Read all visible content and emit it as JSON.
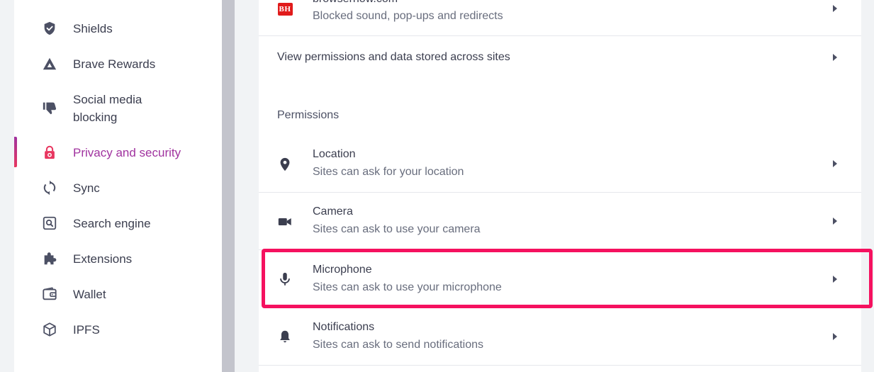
{
  "sidebar": {
    "items": [
      {
        "label": "Shields",
        "icon": "shield-icon"
      },
      {
        "label": "Brave Rewards",
        "icon": "brave-rewards-triangle-icon"
      },
      {
        "label": "Social media\nblocking",
        "icon": "thumbs-down-icon"
      },
      {
        "label": "Privacy and security",
        "icon": "lock-icon",
        "active": true
      },
      {
        "label": "Sync",
        "icon": "sync-icon"
      },
      {
        "label": "Search engine",
        "icon": "search-engine-icon"
      },
      {
        "label": "Extensions",
        "icon": "puzzle-icon"
      },
      {
        "label": "Wallet",
        "icon": "wallet-icon"
      },
      {
        "label": "IPFS",
        "icon": "cube-icon"
      }
    ]
  },
  "content": {
    "site_row": {
      "title": "browserhow.com",
      "subtitle": "Blocked sound, pop-ups and redirects",
      "favicon_text": "BH"
    },
    "view_permissions": {
      "title": "View permissions and data stored across sites"
    },
    "permissions_heading": "Permissions",
    "permissions": [
      {
        "title": "Location",
        "subtitle": "Sites can ask for your location",
        "icon": "location-pin-icon"
      },
      {
        "title": "Camera",
        "subtitle": "Sites can ask to use your camera",
        "icon": "camera-icon"
      },
      {
        "title": "Microphone",
        "subtitle": "Sites can ask to use your microphone",
        "icon": "microphone-icon",
        "highlighted": true
      },
      {
        "title": "Notifications",
        "subtitle": "Sites can ask to send notifications",
        "icon": "bell-icon"
      }
    ]
  },
  "colors": {
    "accent": "#a0329f",
    "highlight": "#f5115f",
    "favicon": "#e11b1b"
  }
}
